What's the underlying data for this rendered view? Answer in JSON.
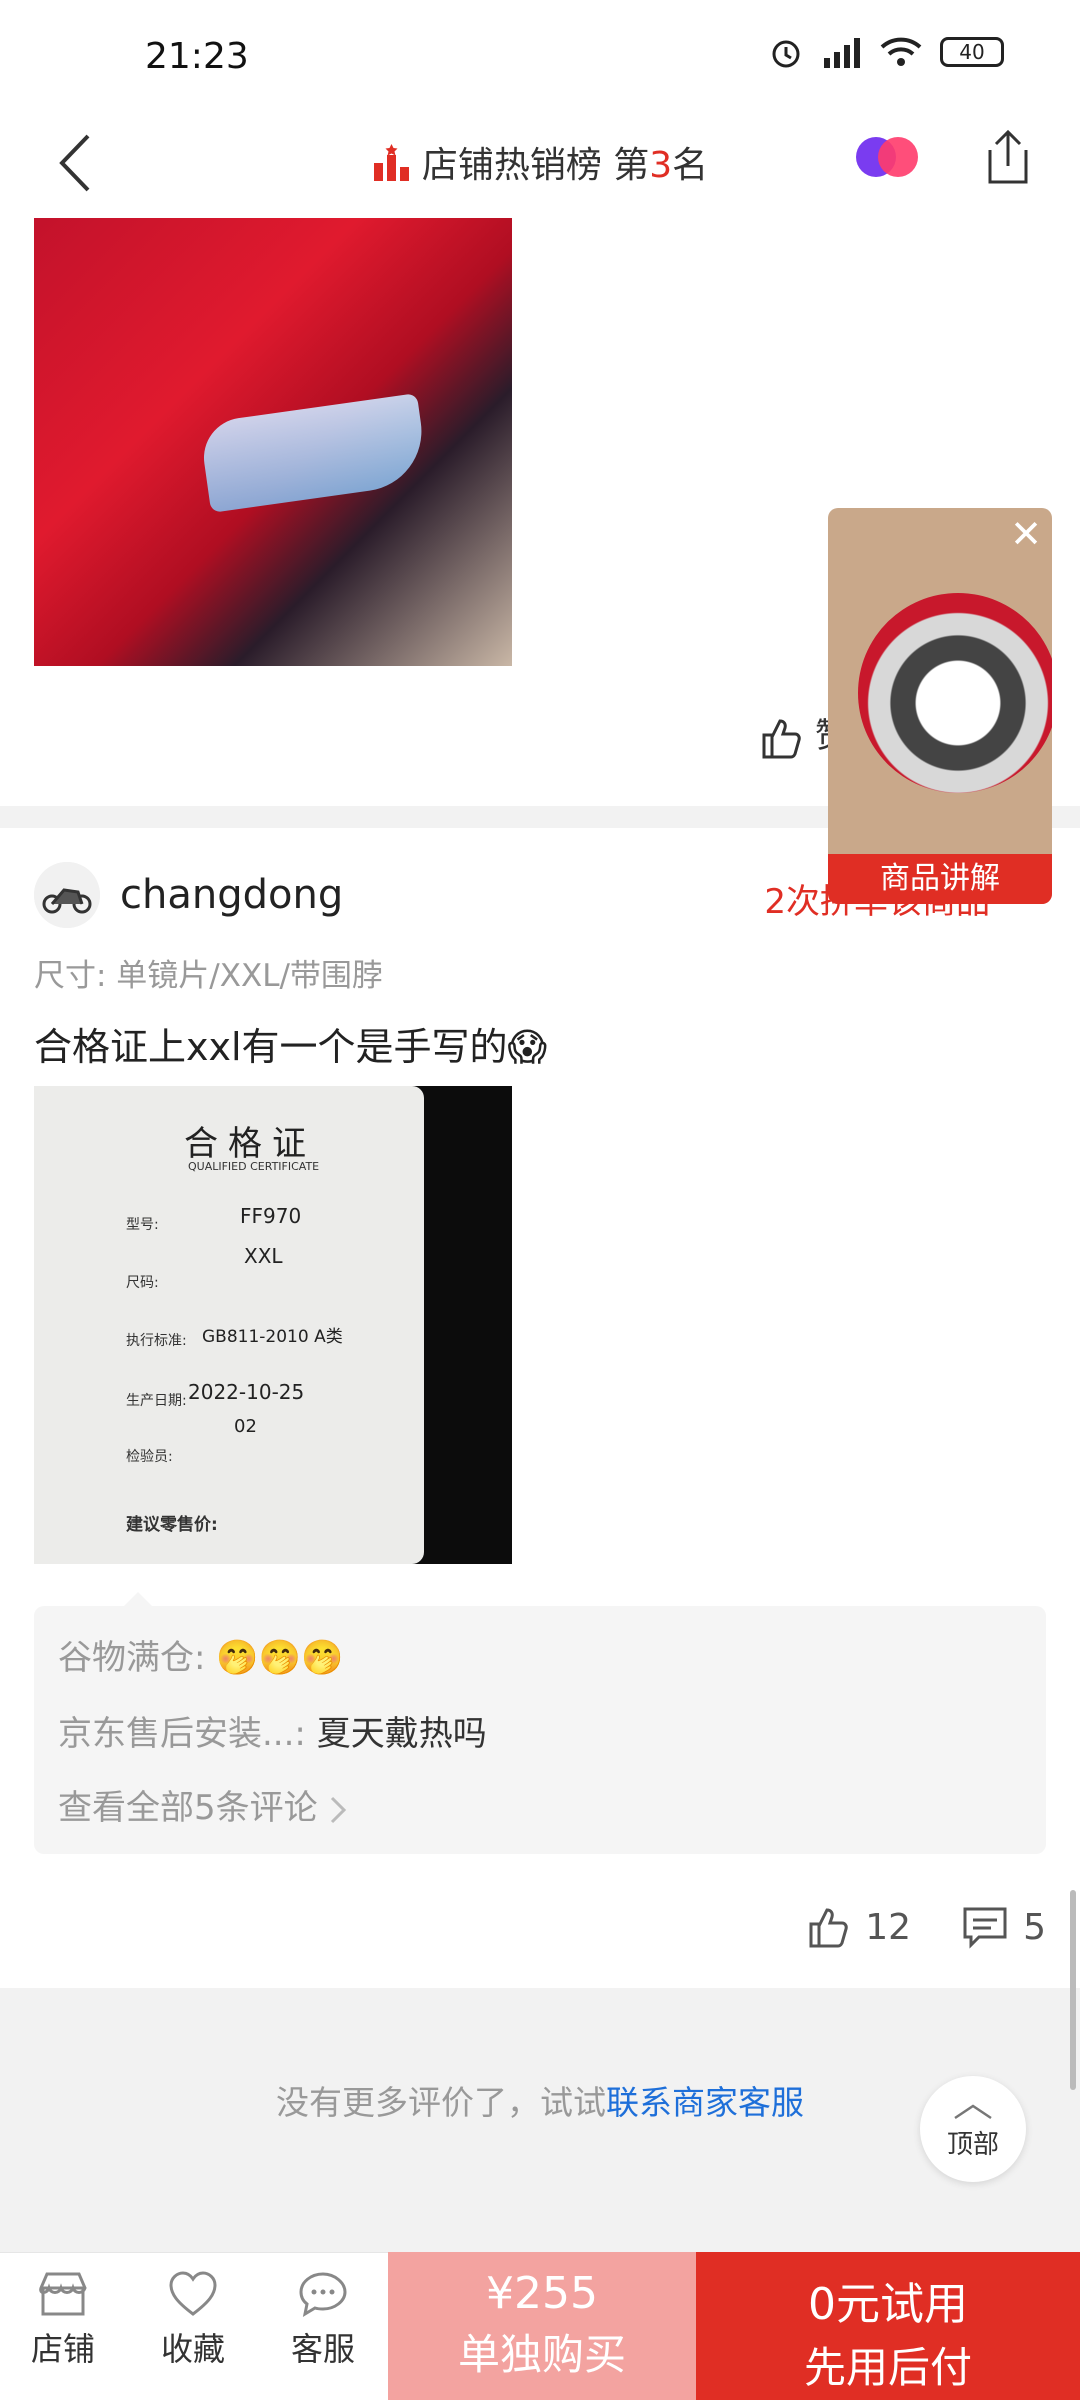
{
  "status_bar": {
    "time": "21:23",
    "battery": "40"
  },
  "nav": {
    "title_prefix": "店铺热销榜 第",
    "rank": "3",
    "title_suffix": "名"
  },
  "review_prev": {
    "like_label": "赞"
  },
  "review": {
    "username": "changdong",
    "repurchase": "2次拼单该商品",
    "spec": "尺寸: 单镜片/XXL/带围脖",
    "comment": "合格证上xxl有一个是手写的😱",
    "certificate": {
      "title": "合格证",
      "subtitle": "QUALIFIED CERTIFICATE",
      "fields": [
        {
          "label": "型号:",
          "value": "FF970"
        },
        {
          "label": "尺码:",
          "value": "XXL"
        },
        {
          "label": "执行标准:",
          "value": "GB811-2010  A类"
        },
        {
          "label": "生产日期:",
          "value": "2022-10-25"
        },
        {
          "label": "检验员:",
          "value": "02"
        }
      ],
      "price_label": "建议零售价:"
    },
    "replies": [
      {
        "user": "谷物满仓:",
        "text": "🤭🤭🤭"
      },
      {
        "user": "京东售后安装...:",
        "text": "夏天戴热吗"
      }
    ],
    "see_all": "查看全部5条评论",
    "likes": "12",
    "comments": "5"
  },
  "footer_note": {
    "text": "没有更多评价了，试试",
    "link": "联系商家客服"
  },
  "top_button": "顶部",
  "floating_video": {
    "label": "商品讲解"
  },
  "bottom_bar": {
    "tabs": [
      "店铺",
      "收藏",
      "客服"
    ],
    "solo_price": "¥255",
    "solo_label": "单独购买",
    "trial_line1": "0元试用",
    "trial_line2": "先用后付"
  },
  "colors": {
    "accent": "#e02e24",
    "link": "#1e6fd9",
    "solo_button": "#f3a3a0"
  }
}
